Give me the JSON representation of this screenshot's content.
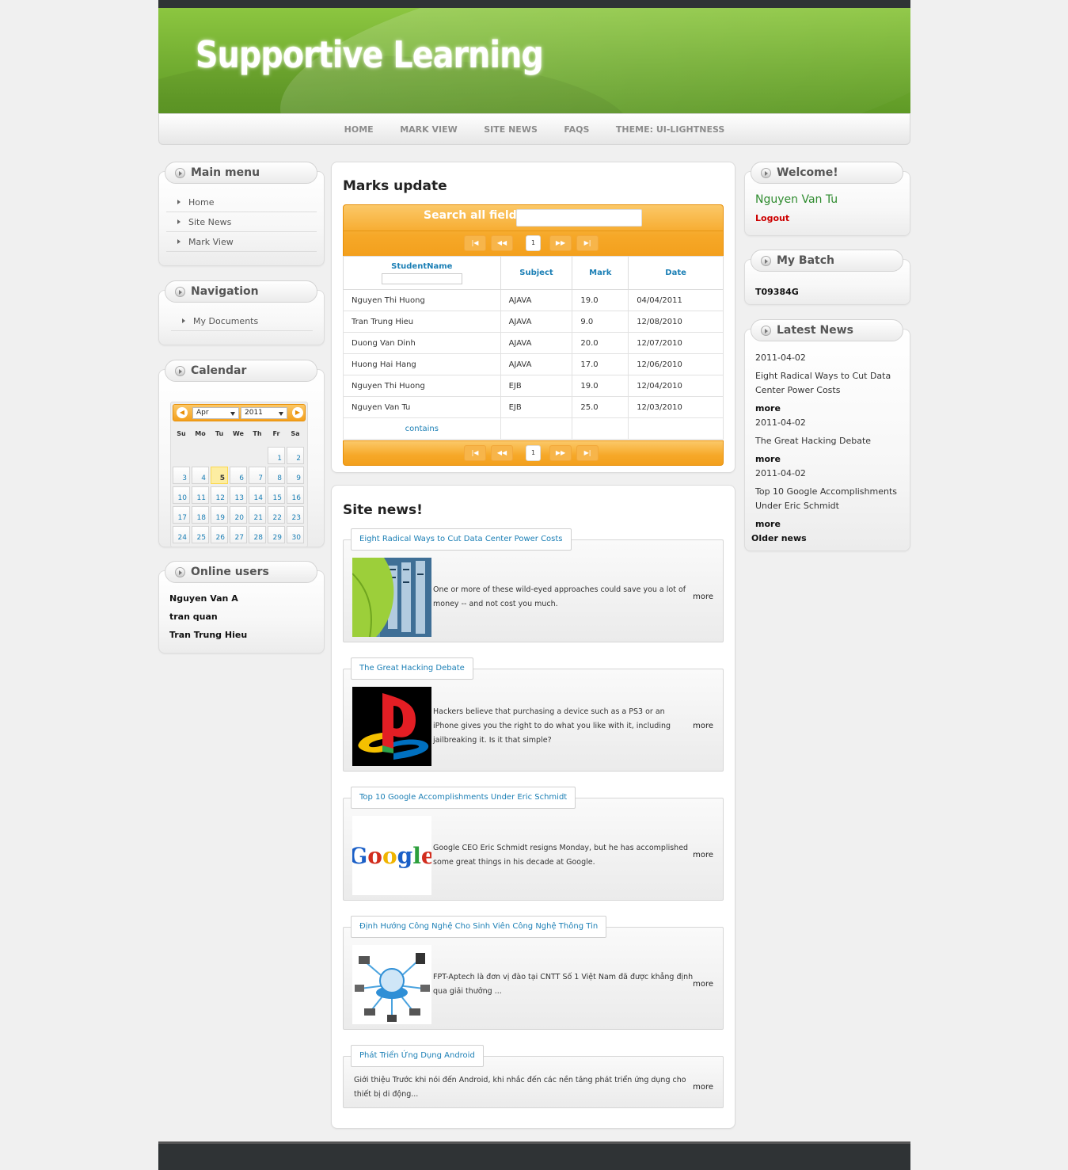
{
  "site": {
    "title": "Supportive Learning"
  },
  "nav": [
    "HOME",
    "MARK VIEW",
    "SITE NEWS",
    "FAQS",
    "THEME: UI-LIGHTNESS"
  ],
  "main_menu": {
    "title": "Main menu",
    "items": [
      "Home",
      "Site News",
      "Mark View"
    ]
  },
  "navigation": {
    "title": "Navigation",
    "items": [
      "My Documents"
    ]
  },
  "calendar": {
    "title": "Calendar",
    "month": "Apr",
    "year": "2011",
    "prev_icon": "circle-triangle-w",
    "next_icon": "circle-triangle-e",
    "weekdays": [
      "Su",
      "Mo",
      "Tu",
      "We",
      "Th",
      "Fr",
      "Sa"
    ],
    "today": "5",
    "weeks": [
      [
        "",
        "",
        "",
        "",
        "",
        "1",
        "2"
      ],
      [
        "3",
        "4",
        "5",
        "6",
        "7",
        "8",
        "9"
      ],
      [
        "10",
        "11",
        "12",
        "13",
        "14",
        "15",
        "16"
      ],
      [
        "17",
        "18",
        "19",
        "20",
        "21",
        "22",
        "23"
      ],
      [
        "24",
        "25",
        "26",
        "27",
        "28",
        "29",
        "30"
      ]
    ]
  },
  "online_users": {
    "title": "Online users",
    "users": [
      "Nguyen Van A",
      "tran quan",
      "Tran Trung Hieu"
    ]
  },
  "marks": {
    "title": "Marks update",
    "search_label": "Search all fields:",
    "page": "1",
    "columns": [
      "StudentName",
      "Subject",
      "Mark",
      "Date"
    ],
    "rows": [
      [
        "Nguyen Thi Huong",
        "AJAVA",
        "19.0",
        "04/04/2011"
      ],
      [
        "Tran Trung Hieu",
        "AJAVA",
        "9.0",
        "12/08/2010"
      ],
      [
        "Duong Van Dinh",
        "AJAVA",
        "20.0",
        "12/07/2010"
      ],
      [
        "Huong Hai Hang",
        "AJAVA",
        "17.0",
        "12/06/2010"
      ],
      [
        "Nguyen Thi Huong",
        "EJB",
        "19.0",
        "12/04/2010"
      ],
      [
        "Nguyen Van Tu",
        "EJB",
        "25.0",
        "12/03/2010"
      ]
    ],
    "filter_op": "contains"
  },
  "site_news": {
    "title": "Site news!",
    "more": "more",
    "items": [
      {
        "title": "Eight Radical Ways to Cut Data Center Power Costs",
        "text": "One or more of these wild-eyed approaches could save you a lot of money -- and not cost you much.",
        "image": "leaf-server-image"
      },
      {
        "title": "The Great Hacking Debate",
        "text": "Hackers believe that purchasing a device such as a PS3 or an iPhone gives you the right to do what you like with it, including jailbreaking it. Is it that simple?",
        "image": "playstation-logo"
      },
      {
        "title": "Top 10 Google Accomplishments Under Eric Schmidt",
        "text": "Google CEO Eric Schmidt resigns Monday, but he has accomplished some great things in his decade at Google.",
        "image": "google-logo"
      },
      {
        "title": "Định Hướng Công Nghệ Cho Sinh Viên Công Nghệ Thông Tin",
        "text": "FPT-Aptech là đơn vị đào tại CNTT Số 1 Việt Nam đã được khẳng định qua giải thưởng ...",
        "image": "network-globe-image"
      },
      {
        "title": "Phát Triển Ứng Dụng Android",
        "text": "Giới thiệu Trước khi nói đến Android, khi nhắc đến các nền tảng phát triển ứng dụng cho thiết bị di động...",
        "image": ""
      }
    ]
  },
  "welcome": {
    "title": "Welcome!",
    "user": "Nguyen Van Tu",
    "logout": "Logout"
  },
  "batch": {
    "title": "My Batch",
    "code": "T09384G"
  },
  "latest_news": {
    "title": "Latest News",
    "more": "more",
    "older": "Older news",
    "items": [
      {
        "date": "2011-04-02",
        "title": "Eight Radical Ways to Cut Data Center Power Costs"
      },
      {
        "date": "2011-04-02",
        "title": "The Great Hacking Debate"
      },
      {
        "date": "2011-04-02",
        "title": "Top 10 Google Accomplishments Under Eric Schmidt"
      }
    ]
  },
  "colors": {
    "accent": "#f6a828",
    "link": "#1b7fb5",
    "banner": "#72ad31",
    "logout": "#cc0000",
    "welcome_user": "#2e8b2e"
  }
}
